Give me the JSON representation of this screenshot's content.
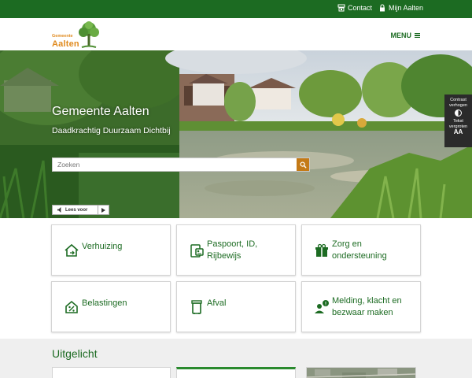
{
  "topbar": {
    "contact_label": "Contact",
    "mijn_label": "Mijn Aalten"
  },
  "header": {
    "logo_small": "Gemeente",
    "logo_big": "Aalten",
    "menu_label": "MENU"
  },
  "hero": {
    "title": "Gemeente Aalten",
    "subtitle": "Daadkrachtig Duurzaam Dichtbij",
    "search_placeholder": "Zoeken",
    "readspeaker_label": "Lees voor"
  },
  "accessibility": {
    "contrast_label_1": "Contrast",
    "contrast_label_2": "verhogen",
    "text_label_1": "Tekst",
    "text_label_2": "vergroten",
    "text_icon": "AA"
  },
  "tiles": [
    {
      "line1": "Verhuizing",
      "line2": "",
      "icon": "house-move-icon"
    },
    {
      "line1": "Paspoort, ID,",
      "line2": "Rijbewijs",
      "icon": "id-card-icon"
    },
    {
      "line1": "Zorg en",
      "line2": "ondersteuning",
      "icon": "gift-care-icon"
    },
    {
      "line1": "Belastingen",
      "line2": "",
      "icon": "tax-house-icon"
    },
    {
      "line1": "Afval",
      "line2": "",
      "icon": "trash-bin-icon"
    },
    {
      "line1": "Melding, klacht en",
      "line2": "bezwaar maken",
      "icon": "report-person-icon"
    }
  ],
  "featured": {
    "title": "Uitgelicht"
  },
  "colors": {
    "brand_green": "#1c6b22",
    "logo_orange": "#e08a1e",
    "search_button": "#c47a17"
  }
}
